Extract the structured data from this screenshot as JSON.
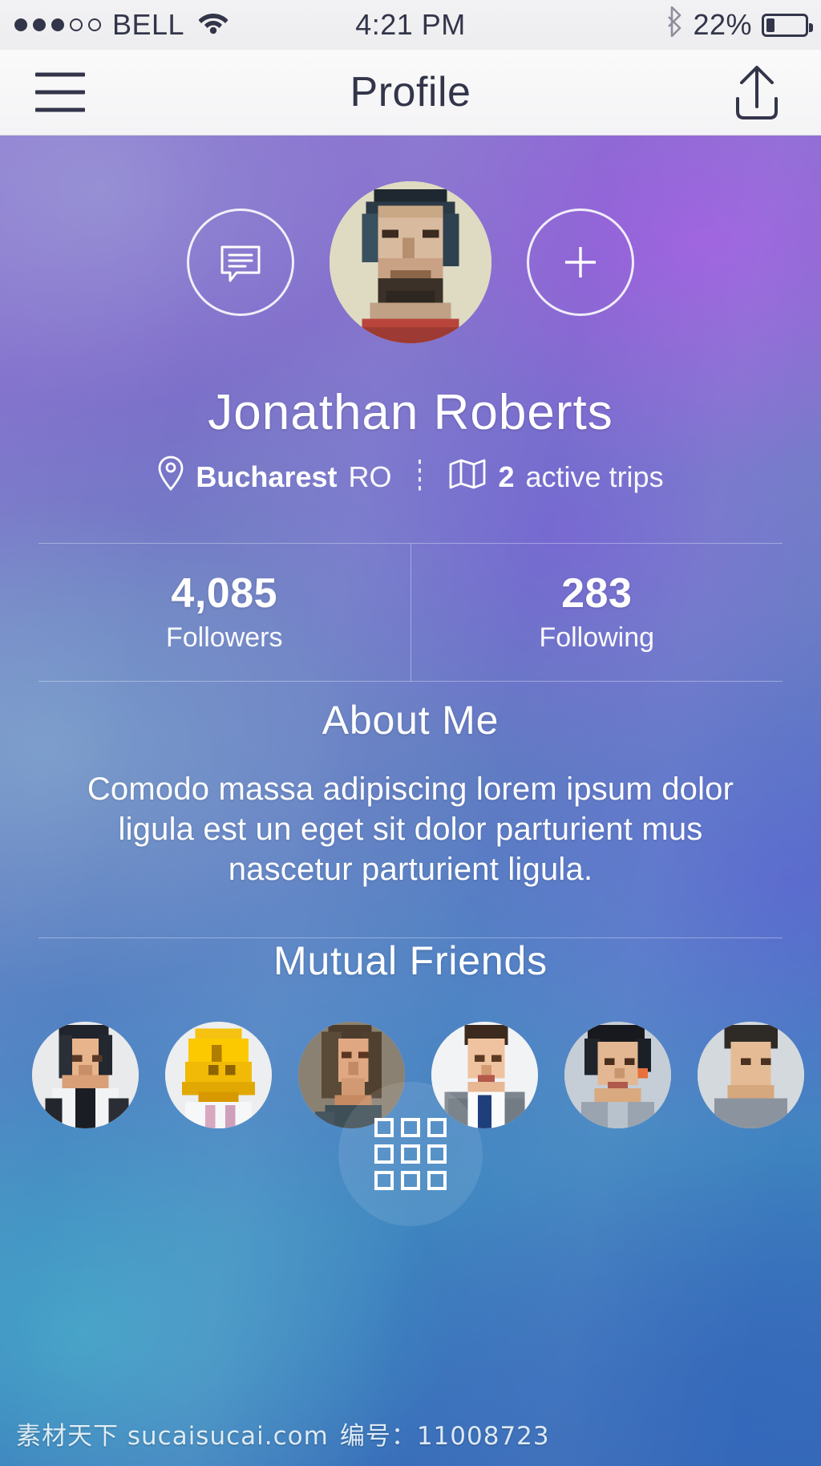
{
  "status_bar": {
    "signal_dots_total": 5,
    "signal_dots_filled": 3,
    "carrier": "BELL",
    "wifi_icon": "wifi-icon",
    "time": "4:21 PM",
    "bluetooth_icon": "bluetooth-icon",
    "battery_percent": "22%",
    "battery_level": 22
  },
  "nav_bar": {
    "menu_icon": "hamburger-menu-icon",
    "title": "Profile",
    "share_icon": "share-upload-icon"
  },
  "profile": {
    "message_icon": "message-bubble-icon",
    "add_icon": "plus-icon",
    "avatar": "user-avatar",
    "name": "Jonathan Roberts",
    "location_icon": "map-pin-icon",
    "location_city": "Bucharest",
    "location_country": "RO",
    "trips_icon": "map-fold-icon",
    "trips_count": "2",
    "trips_label": "active trips"
  },
  "stats": [
    {
      "value": "4,085",
      "label": "Followers"
    },
    {
      "value": "283",
      "label": "Following"
    }
  ],
  "about": {
    "title": "About Me",
    "body": "Comodo massa adipiscing lorem ipsum dolor ligula est un eget sit dolor parturient mus nascetur parturient ligula."
  },
  "mutual_friends": {
    "title": "Mutual Friends",
    "avatars": [
      "friend-avatar-1",
      "friend-avatar-2",
      "friend-avatar-3",
      "friend-avatar-4",
      "friend-avatar-5",
      "friend-avatar-6"
    ]
  },
  "grid_button": {
    "icon": "grid-3x3-icon"
  },
  "watermark": {
    "site": "素材天下 sucaisucai.com",
    "number": "编号：11008723"
  },
  "colors": {
    "nav_text": "#33354a",
    "nav_bg": "#f7f7f9",
    "content_text": "#ffffff",
    "bg_top_left": "#9590ce",
    "bg_top_right": "#8f5fd4",
    "bg_mid_left": "#7da0cc",
    "bg_bottom_left": "#4ba3c7",
    "bg_bottom_right": "#3a6ab8"
  }
}
